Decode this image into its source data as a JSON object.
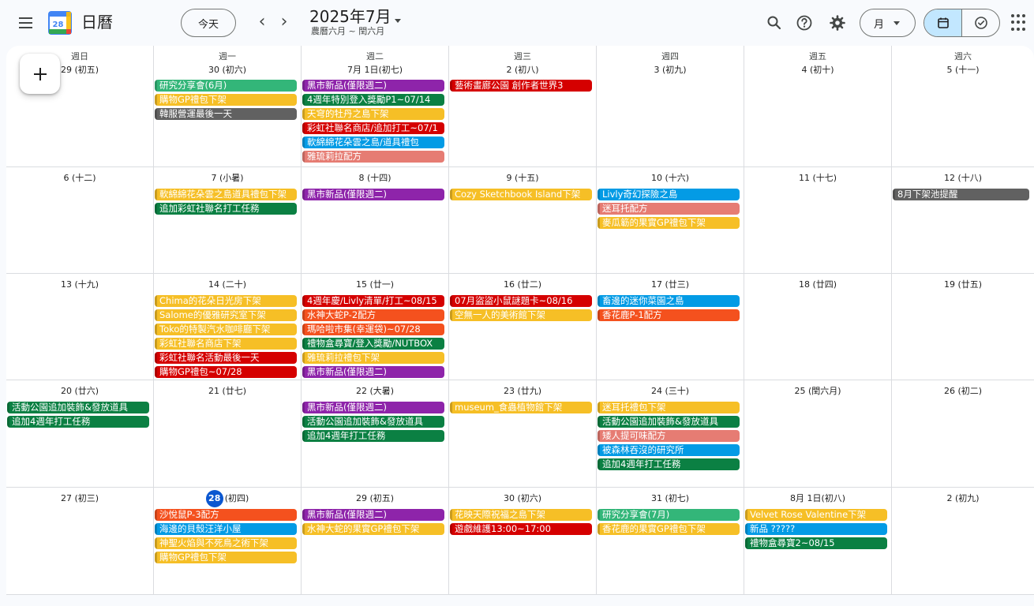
{
  "header": {
    "app_title": "日曆",
    "logo_number": "28",
    "today_label": "今天",
    "prev_label": "‹",
    "next_label": "›",
    "period_title": "2025年7月",
    "period_subtitle": "農曆六月 ~ 閏六月",
    "view_label": "月",
    "icons": [
      "menu-icon",
      "search-icon",
      "help-icon",
      "settings-icon",
      "calendar-icon",
      "tasks-icon",
      "apps-icon"
    ]
  },
  "colors": {
    "sage": "#33b679",
    "banana": "#f6bf26",
    "graphite": "#616161",
    "grape": "#8e24aa",
    "basil": "#0b8043",
    "tangerine": "#f4511e",
    "tomato": "#d50000",
    "peacock": "#039be5",
    "flamingo": "#e67c73",
    "today": "#0b57d0"
  },
  "weekdays": [
    "週日",
    "週一",
    "週二",
    "週三",
    "週四",
    "週五",
    "週六"
  ],
  "weeks": [
    [
      {
        "label": "29 (初五)",
        "events": []
      },
      {
        "label": "30 (初六)",
        "events": [
          {
            "title": "研究分享會(6月)",
            "color": "sage"
          },
          {
            "title": "購物GP禮包下架",
            "color": "banana"
          },
          {
            "title": "韓服營運最後一天",
            "color": "graphite"
          }
        ]
      },
      {
        "label": "7月 1日(初七)",
        "events": [
          {
            "title": "黑市新品(僅限週二)",
            "color": "grape"
          },
          {
            "title": "4週年特別登入獎勵P1~07/14",
            "color": "basil"
          },
          {
            "title": "天穹的牡丹之島下架",
            "color": "banana"
          },
          {
            "title": "彩虹社聯名商店/追加打工~07/1",
            "color": "tomato"
          },
          {
            "title": "軟綿綿花朵雲之島/道具禮包",
            "color": "peacock"
          },
          {
            "title": "雅琉莉拉配方",
            "color": "flamingo"
          }
        ]
      },
      {
        "label": "2 (初八)",
        "events": [
          {
            "title": "藝術畫廊公園 創作者世界3",
            "color": "tomato"
          }
        ]
      },
      {
        "label": "3 (初九)",
        "events": []
      },
      {
        "label": "4 (初十)",
        "events": []
      },
      {
        "label": "5 (十一)",
        "events": []
      }
    ],
    [
      {
        "label": "6 (十二)",
        "events": []
      },
      {
        "label": "7 (小暑)",
        "events": [
          {
            "title": "軟綿綿花朵雲之島道具禮包下架",
            "color": "banana"
          },
          {
            "title": "追加彩虹社聯名打工任務",
            "color": "basil"
          }
        ]
      },
      {
        "label": "8 (十四)",
        "events": [
          {
            "title": "黑市新品(僅限週二)",
            "color": "grape"
          }
        ]
      },
      {
        "label": "9 (十五)",
        "events": [
          {
            "title": "Cozy Sketchbook Island下架",
            "color": "banana"
          }
        ]
      },
      {
        "label": "10 (十六)",
        "events": [
          {
            "title": "Livly奇幻探險之島",
            "color": "peacock"
          },
          {
            "title": "迷耳托配方",
            "color": "flamingo"
          },
          {
            "title": "麥瓜簕的果實GP禮包下架",
            "color": "banana"
          }
        ]
      },
      {
        "label": "11 (十七)",
        "events": []
      },
      {
        "label": "12 (十八)",
        "events": [
          {
            "title": "8月下架池提醒",
            "color": "graphite"
          }
        ]
      }
    ],
    [
      {
        "label": "13 (十九)",
        "events": []
      },
      {
        "label": "14 (二十)",
        "events": [
          {
            "title": "Chima的花朵日光房下架",
            "color": "banana"
          },
          {
            "title": "Salome的優雅研究室下架",
            "color": "banana"
          },
          {
            "title": "Toko的特製汽水咖啡廳下架",
            "color": "banana"
          },
          {
            "title": "彩虹社聯名商店下架",
            "color": "banana"
          },
          {
            "title": "彩虹社聯名活動最後一天",
            "color": "tomato"
          },
          {
            "title": "購物GP禮包~07/28",
            "color": "tomato"
          }
        ]
      },
      {
        "label": "15 (廿一)",
        "events": [
          {
            "title": "4週年慶/Livly清單/打工~08/15",
            "color": "tomato"
          },
          {
            "title": "水神大蛇P-2配方",
            "color": "tangerine"
          },
          {
            "title": "瑪哈啦市集(幸運袋)~07/28",
            "color": "tangerine"
          },
          {
            "title": "禮物盒尋寶/登入獎勵/NUTBOX",
            "color": "basil"
          },
          {
            "title": "雅琉莉拉禮包下架",
            "color": "banana"
          },
          {
            "title": "黑市新品(僅限週二)",
            "color": "grape"
          }
        ]
      },
      {
        "label": "16 (廿二)",
        "events": [
          {
            "title": "07月盜盜小鼠謎題卡~08/16",
            "color": "tomato"
          },
          {
            "title": "空無一人的美術館下架",
            "color": "banana"
          }
        ]
      },
      {
        "label": "17 (廿三)",
        "events": [
          {
            "title": "畜邊的迷你菜園之島",
            "color": "peacock"
          },
          {
            "title": "香花鹿P-1配方",
            "color": "tangerine"
          }
        ]
      },
      {
        "label": "18 (廿四)",
        "events": []
      },
      {
        "label": "19 (廿五)",
        "events": []
      }
    ],
    [
      {
        "label": "20 (廿六)",
        "events": [
          {
            "title": "活動公園追加裝飾&發放道具",
            "color": "basil"
          },
          {
            "title": "追加4週年打工任務",
            "color": "basil"
          }
        ]
      },
      {
        "label": "21 (廿七)",
        "events": []
      },
      {
        "label": "22 (大暑)",
        "events": [
          {
            "title": "黑市新品(僅限週二)",
            "color": "grape"
          },
          {
            "title": "活動公園追加裝飾&發放道具",
            "color": "basil"
          },
          {
            "title": "追加4週年打工任務",
            "color": "basil"
          }
        ]
      },
      {
        "label": "23 (廿九)",
        "events": [
          {
            "title": "museum_食蟲植物館下架",
            "color": "banana"
          }
        ]
      },
      {
        "label": "24 (三十)",
        "events": [
          {
            "title": "迷耳托禮包下架",
            "color": "banana"
          },
          {
            "title": "活動公園追加裝飾&發放道具",
            "color": "basil"
          },
          {
            "title": "矮人提可味配方",
            "color": "flamingo"
          },
          {
            "title": "被森林吞沒的研究所",
            "color": "peacock"
          },
          {
            "title": "追加4週年打工任務",
            "color": "basil"
          }
        ]
      },
      {
        "label": "25 (閏六月)",
        "events": []
      },
      {
        "label": "26 (初二)",
        "events": []
      }
    ],
    [
      {
        "label": "27 (初三)",
        "events": []
      },
      {
        "label": "(初四)",
        "today_num": "28",
        "events": [
          {
            "title": "沙悅鼠P-3配方",
            "color": "tangerine"
          },
          {
            "title": "海邊的貝殼汪洋小屋",
            "color": "peacock"
          },
          {
            "title": "神聖火焰與不死鳥之術下架",
            "color": "banana"
          },
          {
            "title": "購物GP禮包下架",
            "color": "banana"
          }
        ]
      },
      {
        "label": "29 (初五)",
        "events": [
          {
            "title": "黑市新品(僅限週二)",
            "color": "grape"
          },
          {
            "title": "水神大蛇的果實GP禮包下架",
            "color": "banana"
          }
        ]
      },
      {
        "label": "30 (初六)",
        "events": [
          {
            "title": "花映天際祝福之島下架",
            "color": "banana"
          },
          {
            "title": "遊戲維護13:00~17:00",
            "color": "tomato"
          }
        ]
      },
      {
        "label": "31 (初七)",
        "events": [
          {
            "title": "研究分享會(7月)",
            "color": "sage"
          },
          {
            "title": "香花鹿的果實GP禮包下架",
            "color": "banana"
          }
        ]
      },
      {
        "label": "8月 1日(初八)",
        "events": [
          {
            "title": "Velvet Rose Valentine下架",
            "color": "banana"
          },
          {
            "title": "新品 ?????",
            "color": "peacock"
          },
          {
            "title": "禮物盒尋寶2~08/15",
            "color": "basil"
          }
        ]
      },
      {
        "label": "2 (初九)",
        "events": []
      }
    ]
  ]
}
